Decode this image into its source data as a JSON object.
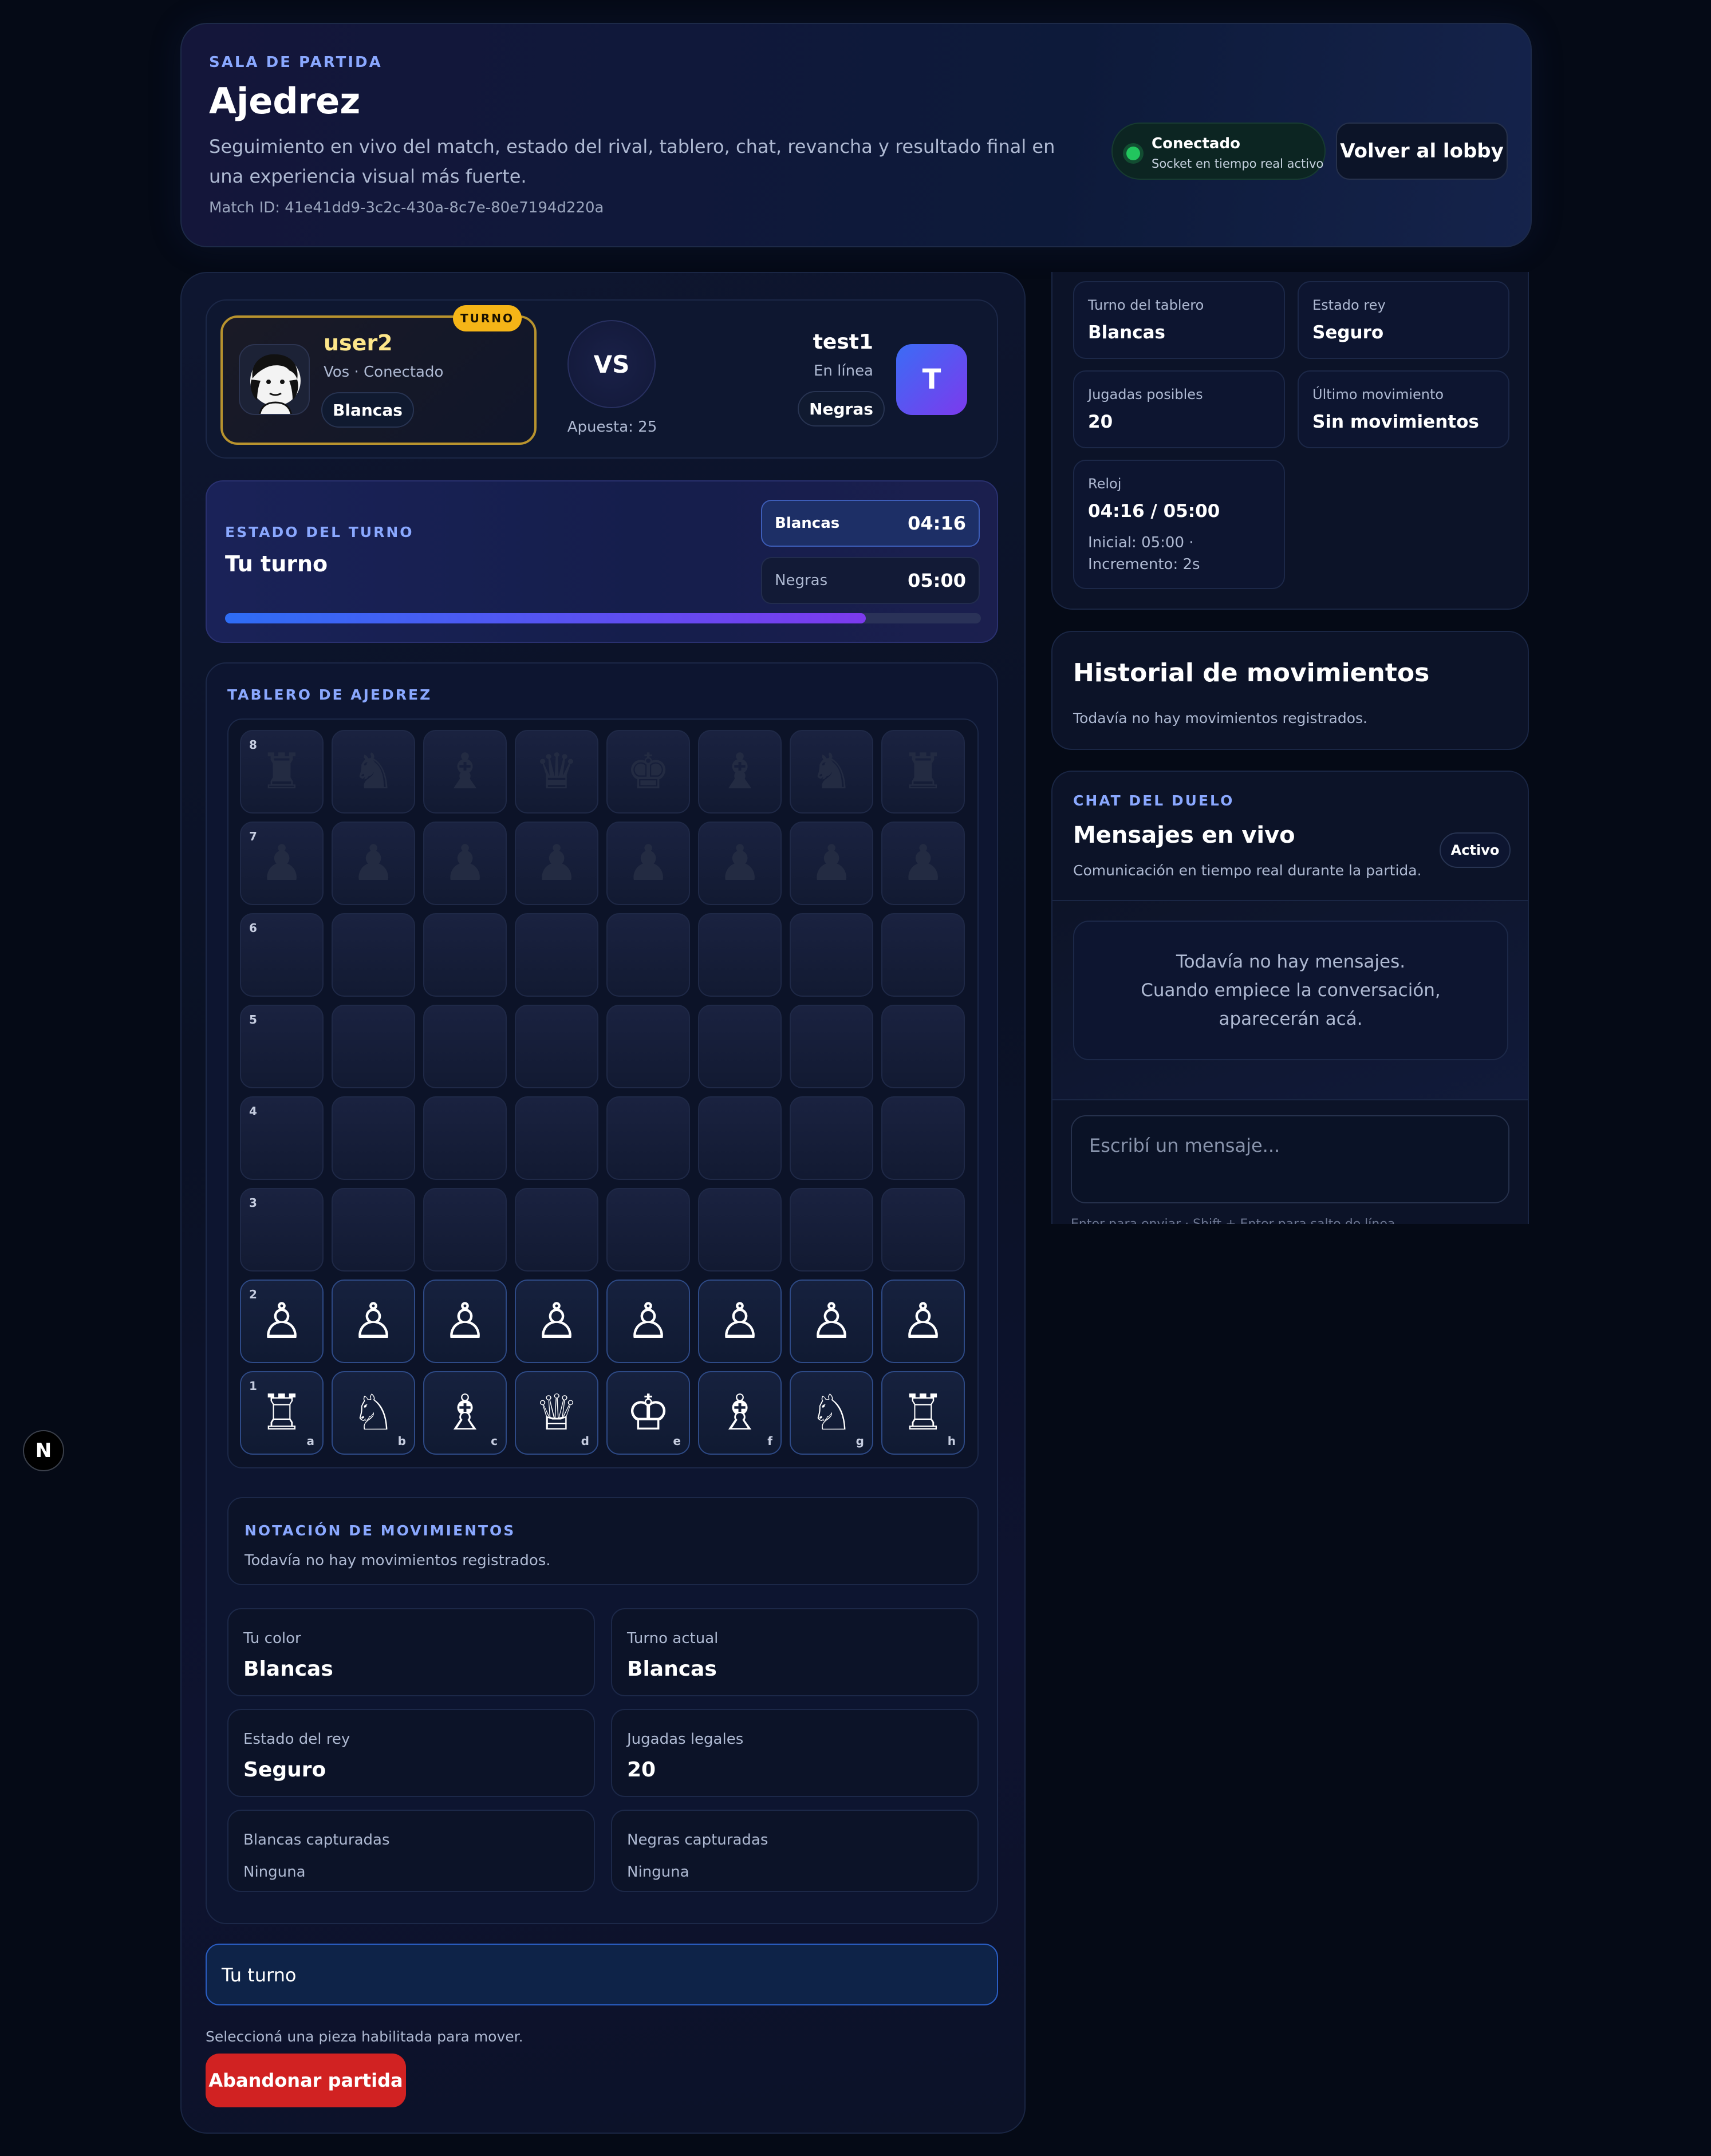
{
  "header": {
    "eyebrow": "SALA DE PARTIDA",
    "title": "Ajedrez",
    "description": "Seguimiento en vivo del match, estado del rival, tablero, chat, revancha y resultado final en una experiencia visual más fuerte.",
    "match_id": "Match ID: 41e41dd9-3c2c-430a-8c7e-80e7194d220a",
    "connection_title": "Conectado",
    "connection_sub": "Socket en tiempo real activo",
    "lobby_button": "Volver al lobby"
  },
  "players": {
    "me": {
      "name": "user2",
      "sub": "Vos · Conectado",
      "color": "Blancas",
      "turn_badge": "TURNO"
    },
    "vs": "VS",
    "stake": "Apuesta: 25",
    "opponent": {
      "name": "test1",
      "sub": "En línea",
      "color": "Negras",
      "initial": "T"
    }
  },
  "turn_state": {
    "eyebrow": "ESTADO DEL TURNO",
    "title": "Tu turno",
    "clocks": [
      {
        "label": "Blancas",
        "time": "04:16"
      },
      {
        "label": "Negras",
        "time": "05:00"
      }
    ],
    "progress": 0.848
  },
  "board": {
    "eyebrow": "TABLERO DE AJEDREZ",
    "ranks": [
      "8",
      "7",
      "6",
      "5",
      "4",
      "3",
      "2",
      "1"
    ],
    "files": [
      "a",
      "b",
      "c",
      "d",
      "e",
      "f",
      "g",
      "h"
    ],
    "rows": [
      [
        "♜",
        "♞",
        "♝",
        "♛",
        "♚",
        "♝",
        "♞",
        "♜"
      ],
      [
        "♟",
        "♟",
        "♟",
        "♟",
        "♟",
        "♟",
        "♟",
        "♟"
      ],
      [
        "",
        "",
        "",
        "",
        "",
        "",
        "",
        ""
      ],
      [
        "",
        "",
        "",
        "",
        "",
        "",
        "",
        ""
      ],
      [
        "",
        "",
        "",
        "",
        "",
        "",
        "",
        ""
      ],
      [
        "",
        "",
        "",
        "",
        "",
        "",
        "",
        ""
      ],
      [
        "♙",
        "♙",
        "♙",
        "♙",
        "♙",
        "♙",
        "♙",
        "♙"
      ],
      [
        "♖",
        "♘",
        "♗",
        "♕",
        "♔",
        "♗",
        "♘",
        "♖"
      ]
    ],
    "piece_colors": {
      "black": "#232b42",
      "white": "#ffffff"
    }
  },
  "notation": {
    "eyebrow": "NOTACIÓN DE MOVIMIENTOS",
    "text": "Todavía no hay movimientos registrados."
  },
  "stats": [
    {
      "label": "Tu color",
      "value": "Blancas"
    },
    {
      "label": "Turno actual",
      "value": "Blancas"
    },
    {
      "label": "Estado del rey",
      "value": "Seguro"
    },
    {
      "label": "Jugadas legales",
      "value": "20"
    },
    {
      "label": "Blancas capturadas",
      "value": "Ninguna"
    },
    {
      "label": "Negras capturadas",
      "value": "Ninguna"
    }
  ],
  "footer": {
    "turn_text": "Tu turno",
    "hint": "Seleccioná una pieza habilitada para mover.",
    "abandon_button": "Abandonar partida"
  },
  "side_stats": [
    {
      "label": "Turno del tablero",
      "value": "Blancas"
    },
    {
      "label": "Estado rey",
      "value": "Seguro"
    },
    {
      "label": "Jugadas posibles",
      "value": "20"
    },
    {
      "label": "Último movimiento",
      "value": "Sin movimientos"
    },
    {
      "label": "Reloj",
      "value": "04:16 / 05:00",
      "sub": "Inicial: 05:00 · Incremento: 2s"
    }
  ],
  "history": {
    "title": "Historial de movimientos",
    "text": "Todavía no hay movimientos registrados."
  },
  "chat": {
    "eyebrow": "CHAT DEL DUELO",
    "title": "Mensajes en vivo",
    "sub": "Comunicación en tiempo real durante la partida.",
    "status": "Activo",
    "empty_line1": "Todavía no hay mensajes.",
    "empty_line2": "Cuando empiece la conversación, aparecerán acá.",
    "input_placeholder": "Escribí un mensaje...",
    "cut_hint": "Enter para enviar · Shift + Enter para salto de línea"
  },
  "dev_badge": "N",
  "colors": {
    "accent": "#8aa8ff",
    "turn_badge": "#f5b517",
    "connected": "#22c55e",
    "danger": "#d12222"
  }
}
